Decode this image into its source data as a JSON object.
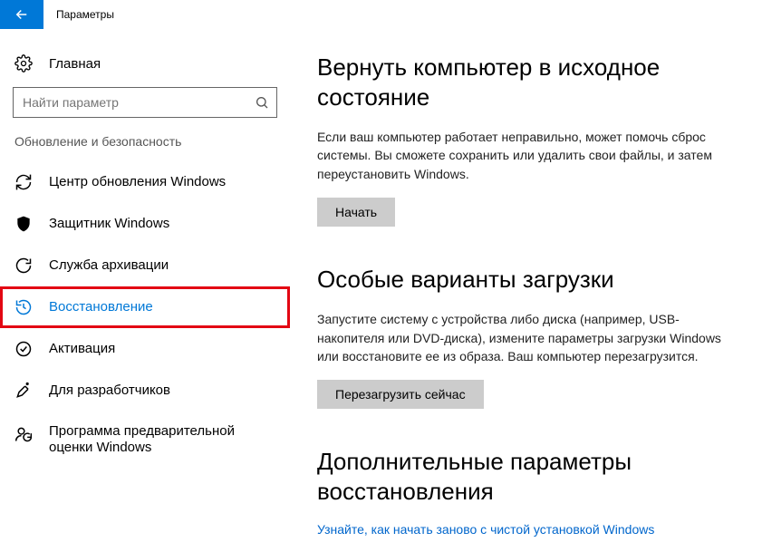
{
  "titlebar": {
    "title": "Параметры"
  },
  "sidebar": {
    "home": "Главная",
    "search_placeholder": "Найти параметр",
    "section": "Обновление и безопасность",
    "items": [
      {
        "label": "Центр обновления Windows"
      },
      {
        "label": "Защитник Windows"
      },
      {
        "label": "Служба архивации"
      },
      {
        "label": "Восстановление"
      },
      {
        "label": "Активация"
      },
      {
        "label": "Для разработчиков"
      },
      {
        "label": "Программа предварительной оценки Windows"
      }
    ]
  },
  "main": {
    "reset": {
      "title": "Вернуть компьютер в исходное состояние",
      "desc": "Если ваш компьютер работает неправильно, может помочь сброс системы. Вы сможете сохранить или удалить свои файлы, и затем переустановить Windows.",
      "button": "Начать"
    },
    "startup": {
      "title": "Особые варианты загрузки",
      "desc": "Запустите систему с устройства либо диска (например, USB-накопителя или DVD-диска), измените параметры загрузки Windows или восстановите ее из образа. Ваш компьютер перезагрузится.",
      "button": "Перезагрузить сейчас"
    },
    "more": {
      "title": "Дополнительные параметры восстановления",
      "link": "Узнайте, как начать заново с чистой установкой Windows"
    }
  }
}
